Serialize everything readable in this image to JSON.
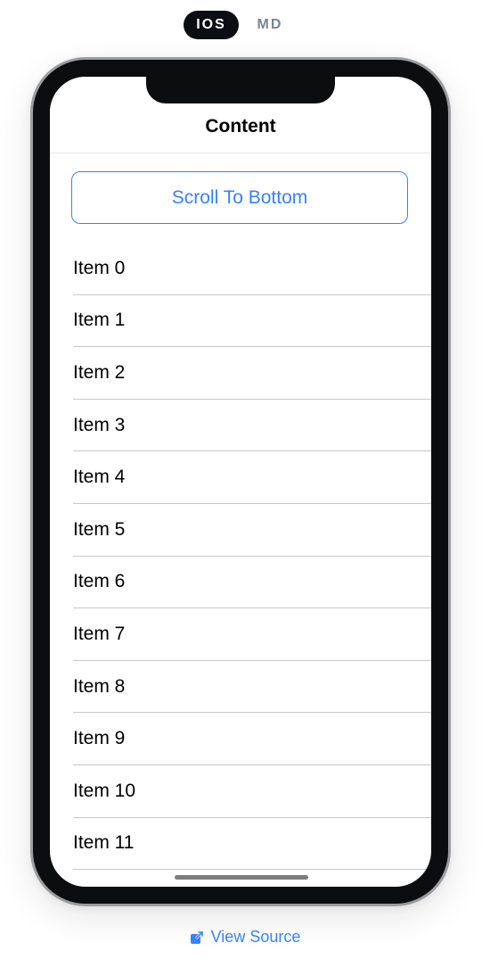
{
  "mode_toggle": {
    "ios_label": "IOS",
    "md_label": "MD",
    "selected": "IOS"
  },
  "toolbar": {
    "title": "Content"
  },
  "main": {
    "scroll_button_label": "Scroll To Bottom",
    "items": [
      "Item 0",
      "Item 1",
      "Item 2",
      "Item 3",
      "Item 4",
      "Item 5",
      "Item 6",
      "Item 7",
      "Item 8",
      "Item 9",
      "Item 10",
      "Item 11"
    ]
  },
  "footer": {
    "view_source_label": "View Source",
    "icon": "external-link-icon"
  },
  "colors": {
    "accent": "#3880ff",
    "toggle_active_bg": "#0b0d12",
    "divider": "#c8c7cc"
  }
}
